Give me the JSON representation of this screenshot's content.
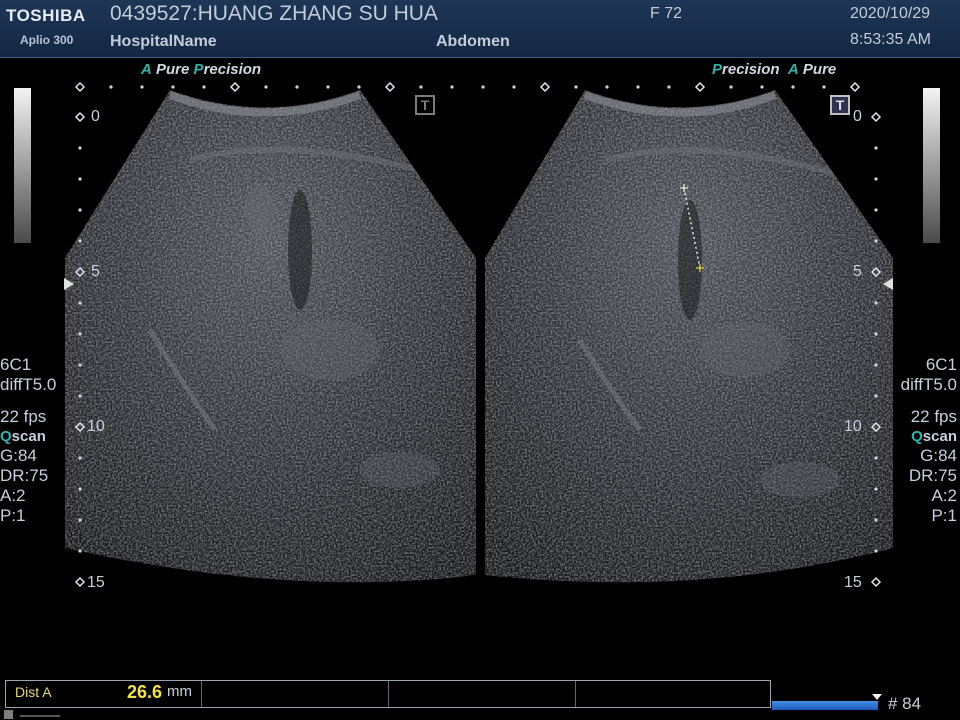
{
  "header": {
    "brand": "TOSHIBA",
    "model": "Aplio 300",
    "patient": "0439527:HUANG ZHANG SU HUA",
    "hospital": "HospitalName",
    "sex_age": "F  72",
    "exam": "Abdomen",
    "date": "2020/10/29",
    "time": "8:53:35 AM"
  },
  "left_image": {
    "tag": {
      "a": "A",
      "pure": "Pure",
      "p": "P",
      "precision": "recision"
    },
    "depth_labels": [
      "0",
      "5",
      "10",
      "15"
    ],
    "t_icon": "T"
  },
  "right_image": {
    "tag": {
      "p": "P",
      "precision": "recision",
      "a": "A",
      "pure": "Pure"
    },
    "depth_labels": [
      "0",
      "5",
      "10",
      "15"
    ],
    "t_icon": "T"
  },
  "left_params": {
    "probe": "6C1",
    "mode": "diffT5.0",
    "fps": "22 fps",
    "q": "Q",
    "scan": "scan",
    "gain": "G:84",
    "dr": "DR:75",
    "a": "A:2",
    "p": "P:1"
  },
  "right_params": {
    "probe": "6C1",
    "mode": "diffT5.0",
    "fps": "22 fps",
    "q": "Q",
    "scan": "scan",
    "gain": "G:84",
    "dr": "DR:75",
    "a": "A:2",
    "p": "P:1"
  },
  "measurement": {
    "label": "Dist A",
    "value": "26.6",
    "unit": "mm"
  },
  "cine": {
    "frame_label": "# 84"
  },
  "colors": {
    "header_bg": "#1a2e4d",
    "accent_teal": "#2fb3ad",
    "measure_yellow": "#f2e23a",
    "cine_bar": "#3a86e0"
  }
}
